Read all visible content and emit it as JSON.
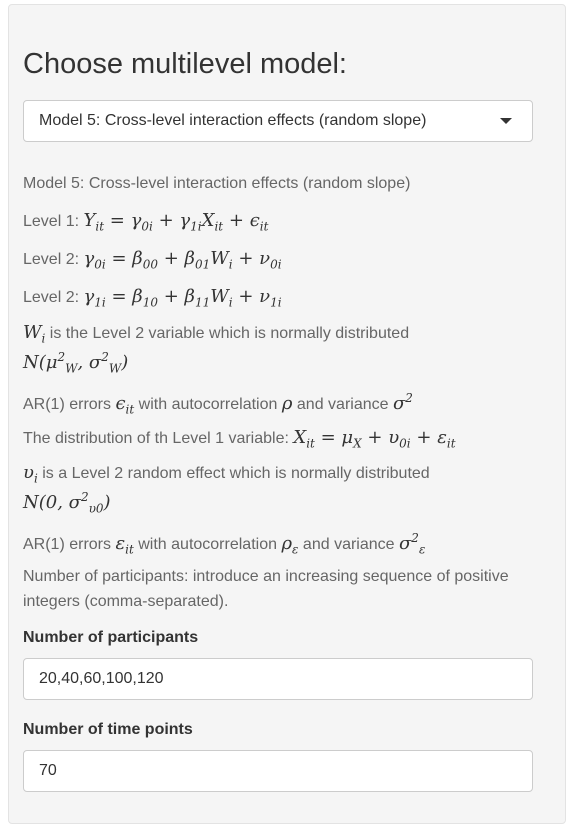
{
  "title": "Choose multilevel model:",
  "model_select": {
    "selected": "Model 5: Cross-level interaction effects (random slope)"
  },
  "description": {
    "model_name": "Model 5: Cross-level interaction effects (random slope)",
    "level1_prefix": "Level 1: ",
    "level2a_prefix": "Level 2: ",
    "level2b_prefix": "Level 2: ",
    "wi_text": " is the Level 2 variable which is normally distributed",
    "ar1_a_prefix": "AR(1) errors ",
    "ar1_a_mid": " with autocorrelation ",
    "ar1_a_end": " and variance ",
    "dist_text": "The distribution of th Level 1 variable: ",
    "vi_text": " is a Level 2 random effect which is normally distributed",
    "ar1_b_prefix": "AR(1) errors ",
    "ar1_b_mid": " with autocorrelation ",
    "ar1_b_end": " and variance ",
    "participants_help": "Number of participants: introduce an increasing sequence of positive integers (comma-separated)."
  },
  "participants": {
    "label": "Number of participants",
    "value": "20,40,60,100,120"
  },
  "time_points": {
    "label": "Number of time points",
    "value": "70"
  }
}
